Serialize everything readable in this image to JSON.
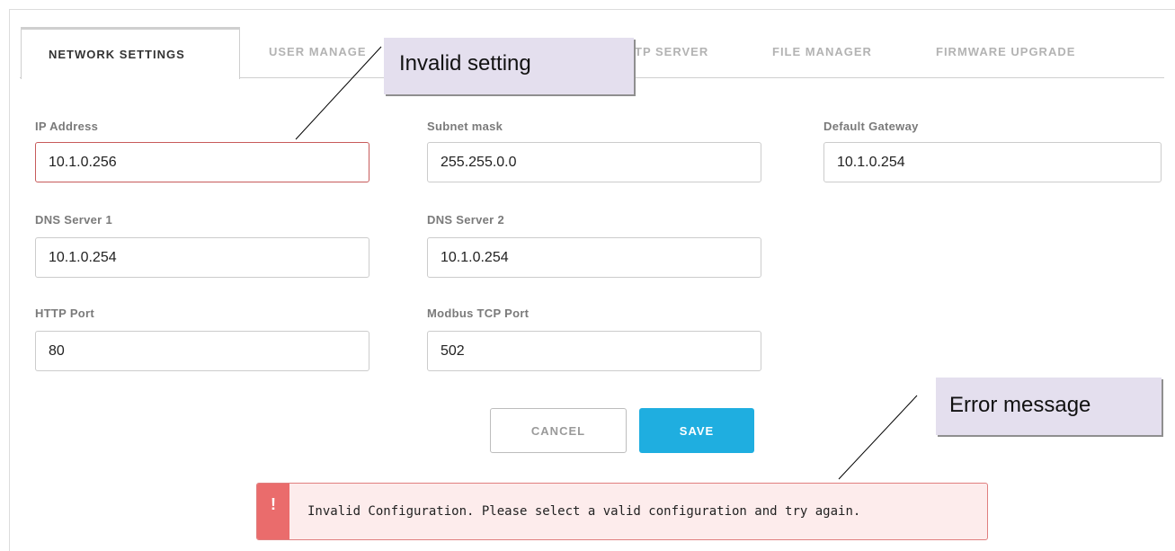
{
  "tabs": [
    {
      "label": "NETWORK SETTINGS",
      "active": true
    },
    {
      "label": "USER MANAGE"
    },
    {
      "label": "TP SERVER"
    },
    {
      "label": "FILE MANAGER"
    },
    {
      "label": "FIRMWARE UPGRADE"
    }
  ],
  "form": {
    "ip_address": {
      "label": "IP Address",
      "value": "10.1.0.256",
      "invalid": true
    },
    "subnet_mask": {
      "label": "Subnet mask",
      "value": "255.255.0.0"
    },
    "default_gateway": {
      "label": "Default Gateway",
      "value": "10.1.0.254"
    },
    "dns1": {
      "label": "DNS Server 1",
      "value": "10.1.0.254"
    },
    "dns2": {
      "label": "DNS Server 2",
      "value": "10.1.0.254"
    },
    "http_port": {
      "label": "HTTP Port",
      "value": "80"
    },
    "modbus_port": {
      "label": "Modbus TCP Port",
      "value": "502"
    }
  },
  "buttons": {
    "cancel": "CANCEL",
    "save": "SAVE"
  },
  "alert": {
    "icon": "!",
    "message": "Invalid Configuration. Please select a valid configuration and try again."
  },
  "annotations": {
    "invalid_setting": "Invalid setting",
    "error_message": "Error message"
  },
  "colors": {
    "accent": "#1faee0",
    "error": "#ea6c6c",
    "error_bg": "#fdecec",
    "callout_bg": "#e4dfee"
  }
}
